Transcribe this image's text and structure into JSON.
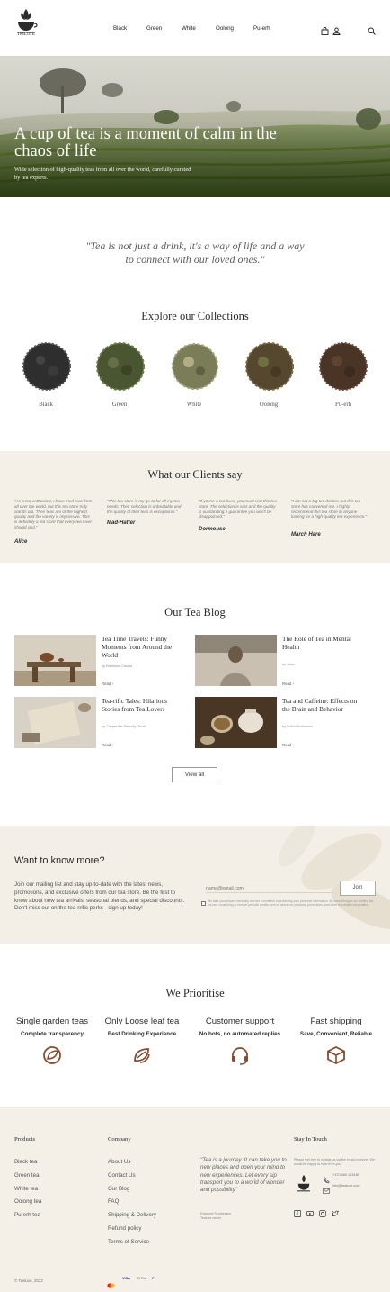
{
  "header": {
    "logo_text": "TeaLuxE",
    "nav": [
      "Black",
      "Green",
      "White",
      "Oolong",
      "Pu-erh"
    ]
  },
  "hero": {
    "title": "A cup of tea is a moment of calm in the chaos of life",
    "subtitle": "Wide selection of high-quality teas from all over the world, carefully curated by tea experts."
  },
  "quote": "\"Tea is not just a drink, it's a way of life and a way to connect with our loved ones.\"",
  "collections": {
    "title": "Explore our Collections",
    "items": [
      "Black",
      "Green",
      "White",
      "Oolong",
      "Pu-erh"
    ]
  },
  "clients": {
    "title": "What our Clients say",
    "reviews": [
      {
        "text": "\"As a tea enthusiast, I have tried teas from all over the world, but this tea store truly stands out. Their teas are of the highest quality and the variety is impressive. This is definitely a tea store that every tea lover should visit.\"",
        "name": "Alice"
      },
      {
        "text": "\"This tea store is my go-to for all my tea needs. Their selection is unbeatable and the quality of their teas is exceptional.\"",
        "name": "Mad-Hatter"
      },
      {
        "text": "\"If you're a tea lover, you must visit this tea store. The selection is vast and the quality is outstanding. I guarantee you won't be disappointed.\"",
        "name": "Dormouse"
      },
      {
        "text": "\"I am not a big tea drinker, but this tea store has converted me. I highly recommend this tea store to anyone looking for a high-quality tea experience.\"",
        "name": "March Hare"
      }
    ]
  },
  "blog": {
    "title": "Our Tea Blog",
    "posts": [
      {
        "title": "Tea Time Travels: Funny Moments from Around the World",
        "author": "by Robinson Crusoe",
        "read": "Read"
      },
      {
        "title": "The Role of Tea in Mental Health",
        "author": "by Joker",
        "read": "Read"
      },
      {
        "title": "Tea-rific Tales: Hilarious Stories from Tea Lovers",
        "author": "by Casper the Friendly Ghost",
        "read": "Read"
      },
      {
        "title": "Tea and Caffeine: Effects on the Brain and Behavior",
        "author": "by Author Authorous",
        "read": "Read"
      }
    ],
    "view_all": "View all"
  },
  "newsletter": {
    "title": "Want to know more?",
    "text": "Join our mailing list and stay up-to-date with the latest news, promotions, and exclusive offers from our tea store. Be the first to know about new tea arrivals, seasonal blends, and special discounts. Don't miss out on the tea-rrific perks - sign up today!",
    "placeholder": "name@email.com",
    "join": "Join",
    "consent": "We take your privacy seriously and are committed to protecting your personal information. By subscribing to our mailing list, you are consenting to receive periodic emails from us about our products, promotions, and other tea-related information."
  },
  "prioritise": {
    "title": "We Prioritise",
    "items": [
      {
        "heading": "Single garden teas",
        "sub": "Complete transparency",
        "icon": "globe-leaf-icon"
      },
      {
        "heading": "Only Loose leaf tea",
        "sub": "Best Drinking Experience",
        "icon": "leaves-icon"
      },
      {
        "heading": "Customer support",
        "sub": "No bots, no automated replies",
        "icon": "headset-icon"
      },
      {
        "heading": "Fast shipping",
        "sub": "Save, Convenient, Reliable",
        "icon": "box-icon"
      }
    ]
  },
  "footer": {
    "products_title": "Products",
    "products": [
      "Black tea",
      "Green tea",
      "White tea",
      "Oolong tea",
      "Pu-erh tea"
    ],
    "company_title": "Company",
    "company": [
      "About Us",
      "Contact Us",
      "Our Blog",
      "FAQ",
      "Shipping & Delivery",
      "Refund policy",
      "Terms of Service"
    ],
    "quote": "\"Tea is a journey. It can take you to new places and open your mind to new experiences. Let every sip transport you to a world of wonder and possibility\"",
    "quote_author": "Dragomir Teodorescu,\nTealuxe owner",
    "stay_title": "Stay In Touch",
    "stay_text": "Please feel free to contact us via the email of phone. We would be happy to hear from you!",
    "phone": "+370 680 123456",
    "email": "info@tealuxe.com",
    "copyright": "© Tealuxe, 2023",
    "payments": [
      "VISA",
      "G Pay",
      "P"
    ]
  },
  "colors": {
    "beige": "#f4f0e8",
    "icon_brown": "#8a4a2e"
  }
}
